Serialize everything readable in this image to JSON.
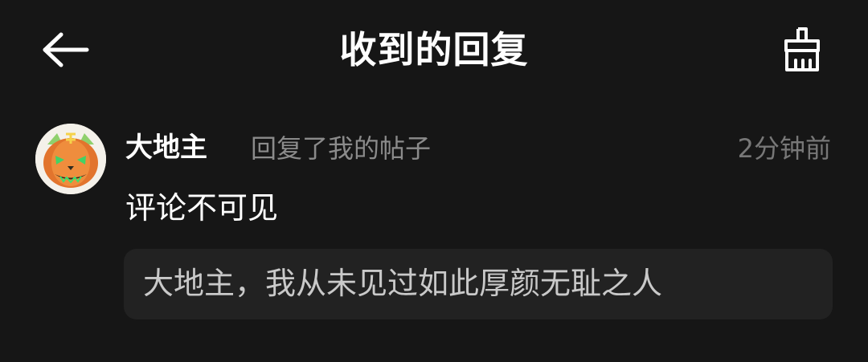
{
  "header": {
    "title": "收到的回复",
    "back_icon": "arrow-left-icon",
    "clean_icon": "broom-icon"
  },
  "reply": {
    "avatar": "pumpkin-avatar",
    "username": "大地主",
    "action": "回复了我的帖子",
    "time": "2分钟前",
    "comment": "评论不可见",
    "quote": "大地主，我从未见过如此厚颜无耻之人"
  },
  "colors": {
    "background": "#161616",
    "quote_background": "#222222",
    "secondary_text": "#8b8b8b",
    "primary_text": "#ffffff"
  }
}
